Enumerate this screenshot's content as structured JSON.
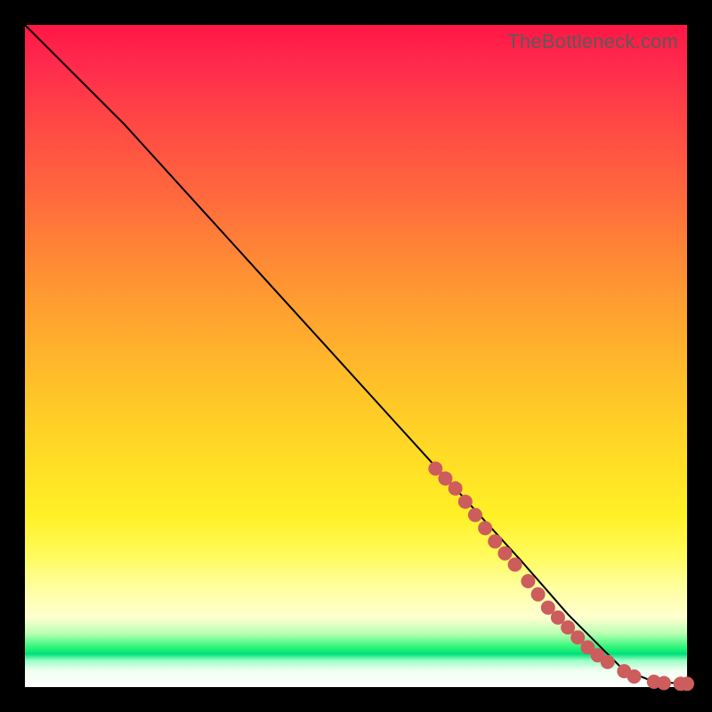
{
  "watermark": "TheBottleneck.com",
  "chart_data": {
    "type": "line",
    "title": "",
    "xlabel": "",
    "ylabel": "",
    "xlim": [
      0,
      100
    ],
    "ylim": [
      0,
      100
    ],
    "grid": false,
    "series": [
      {
        "name": "curve",
        "x": [
          0,
          3,
          8,
          15,
          25,
          35,
          45,
          55,
          65,
          75,
          82,
          87,
          90,
          92,
          94,
          96,
          98,
          100
        ],
        "y": [
          100,
          97,
          92,
          85,
          74,
          63,
          52,
          41,
          30,
          19,
          11,
          6,
          3,
          2,
          1.2,
          0.8,
          0.6,
          0.5
        ]
      }
    ],
    "points": [
      {
        "x": 62,
        "y": 33
      },
      {
        "x": 63.5,
        "y": 31.5
      },
      {
        "x": 65,
        "y": 30
      },
      {
        "x": 66.5,
        "y": 28
      },
      {
        "x": 68,
        "y": 26
      },
      {
        "x": 69.5,
        "y": 24
      },
      {
        "x": 71,
        "y": 22
      },
      {
        "x": 72.5,
        "y": 20.2
      },
      {
        "x": 74,
        "y": 18.5
      },
      {
        "x": 76,
        "y": 16
      },
      {
        "x": 77.5,
        "y": 14
      },
      {
        "x": 79,
        "y": 12
      },
      {
        "x": 80.5,
        "y": 10.5
      },
      {
        "x": 82,
        "y": 9
      },
      {
        "x": 83.5,
        "y": 7.5
      },
      {
        "x": 85,
        "y": 6
      },
      {
        "x": 86.5,
        "y": 4.8
      },
      {
        "x": 88,
        "y": 3.8
      },
      {
        "x": 90.5,
        "y": 2.4
      },
      {
        "x": 92,
        "y": 1.6
      },
      {
        "x": 95,
        "y": 0.8
      },
      {
        "x": 96.5,
        "y": 0.6
      },
      {
        "x": 99,
        "y": 0.5
      },
      {
        "x": 100,
        "y": 0.5
      }
    ]
  }
}
